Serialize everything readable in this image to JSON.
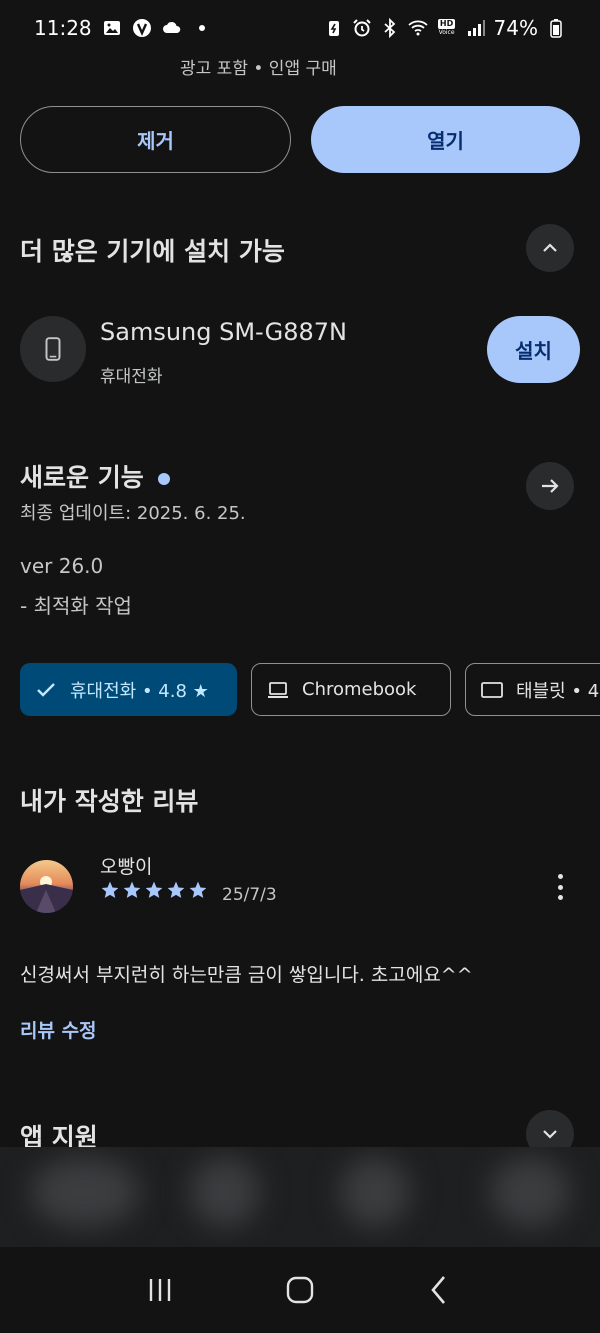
{
  "status_bar": {
    "time": "11:28",
    "left_icons": [
      "image-icon",
      "v-app-icon",
      "cloud-icon",
      "dot-icon"
    ],
    "right_icons": [
      "battery-saver-icon",
      "alarm-icon",
      "bluetooth-icon",
      "wifi-icon",
      "hd-voice-icon",
      "signal-icon"
    ],
    "hd_label": "HD",
    "voice_label": "Voice",
    "battery": "74%"
  },
  "app_header": {
    "ad_note": "광고 포함 • 인앱 구매"
  },
  "actions": {
    "uninstall_label": "제거",
    "open_label": "열기"
  },
  "more_devices": {
    "title": "더 많은 기기에 설치 가능",
    "device_name": "Samsung SM-G887N",
    "device_type": "휴대전화",
    "install_label": "설치"
  },
  "whats_new": {
    "title": "새로운 기능",
    "updated": "최종 업데이트: 2025. 6. 25.",
    "version": "ver 26.0",
    "notes": "- 최적화 작업"
  },
  "device_chips": [
    {
      "label": "휴대전화 • 4.8 ★",
      "selected": true,
      "icon": "check-icon"
    },
    {
      "label": "Chromebook",
      "selected": false,
      "icon": "laptop-icon"
    },
    {
      "label": "태블릿 • 4",
      "selected": false,
      "icon": "tablet-icon"
    }
  ],
  "my_review": {
    "title": "내가 작성한 리뷰",
    "reviewer": "오빵이",
    "rating": 5,
    "date": "25/7/3",
    "text": "신경써서 부지런히 하는만큼 금이 쌓입니다. 초고에요^^",
    "edit_label": "리뷰 수정"
  },
  "app_support": {
    "title": "앱 지원"
  },
  "colors": {
    "background": "#131314",
    "accent": "#a8c7fa",
    "chip_selected": "#004a77",
    "text_primary": "#e3e3e3",
    "text_secondary": "#c4c7c5"
  }
}
